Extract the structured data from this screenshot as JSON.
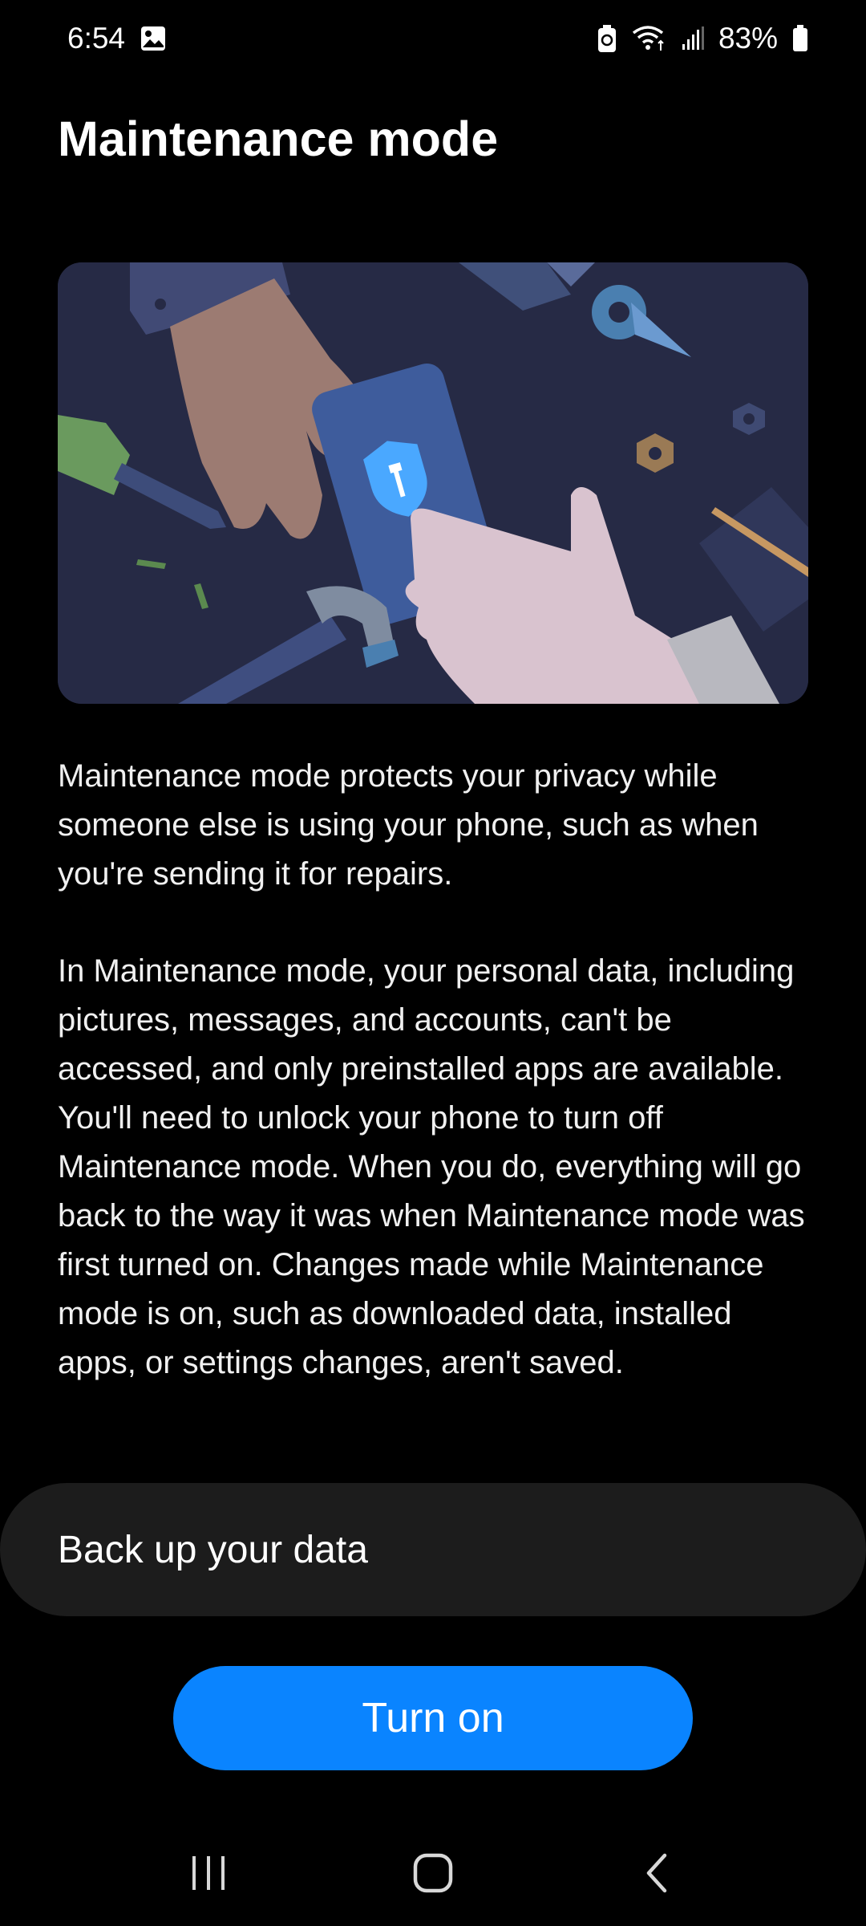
{
  "status_bar": {
    "time": "6:54",
    "battery_percent": "83%",
    "icons": [
      "image-notification-icon",
      "battery-saver-icon",
      "wifi-icon",
      "cellular-signal-icon",
      "battery-icon"
    ]
  },
  "page": {
    "title": "Maintenance mode"
  },
  "illustration": {
    "description_icon": "shield-wrench-icon"
  },
  "body": {
    "paragraph_1": "Maintenance mode protects your privacy while someone else is using your phone, such as when you're sending it for repairs.",
    "paragraph_2": "In Maintenance mode, your personal data, including pictures, messages, and accounts, can't be accessed, and only preinstalled apps are available. You'll need to unlock your phone to turn off Maintenance mode. When you do, everything will go back to the way it was when Maintenance mode was first turned on. Changes made while Maintenance mode is on, such as downloaded data, installed apps, or settings changes, aren't saved."
  },
  "actions": {
    "backup_label": "Back up your data",
    "turn_on_label": "Turn on"
  },
  "navigation": {
    "buttons": [
      "recents-icon",
      "home-icon",
      "back-icon"
    ]
  },
  "colors": {
    "background": "#000000",
    "accent": "#0a84ff",
    "card": "#1c1c1c",
    "illustration_bg": "#262a45"
  }
}
